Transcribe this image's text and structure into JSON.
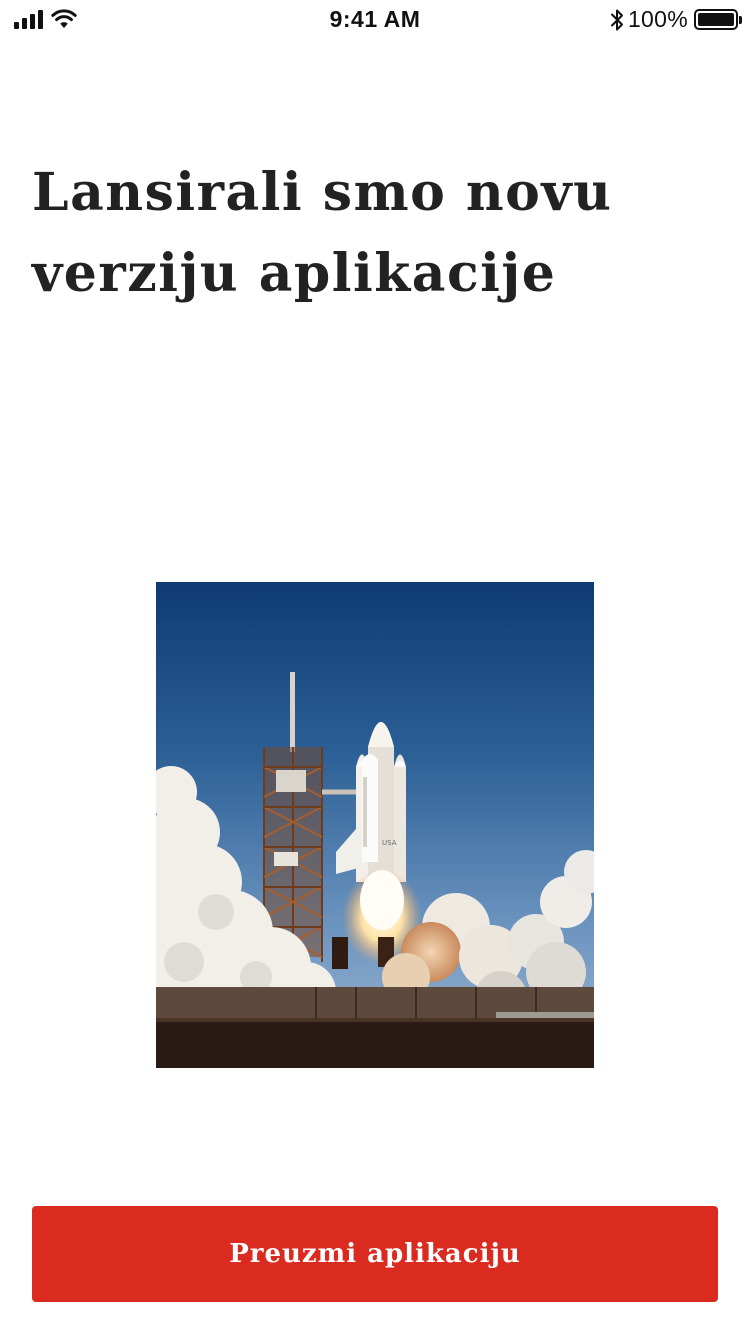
{
  "status_bar": {
    "time": "9:41 AM",
    "battery_percent": "100%",
    "signal_icon": "cellular-signal-icon",
    "wifi_icon": "wifi-icon",
    "bluetooth_icon": "bluetooth-icon",
    "battery_icon": "battery-icon",
    "battery_level": 1.0
  },
  "main": {
    "headline": "Lansirali smo novu verziju aplikacije",
    "hero_image_icon": "space-shuttle-launch-photo"
  },
  "cta": {
    "label": "Preuzmi aplikaciju",
    "color": "#db2a1f"
  }
}
